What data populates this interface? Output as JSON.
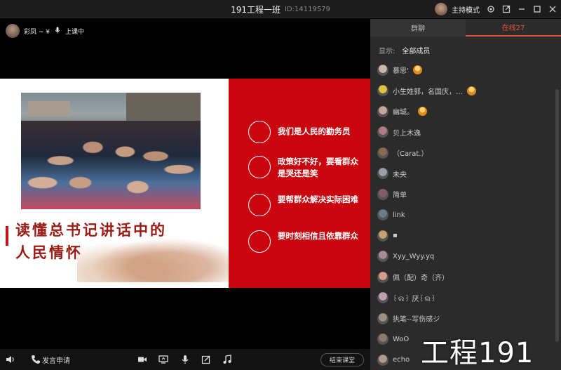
{
  "window": {
    "title": "191工程一班",
    "room_id": "ID:14119579",
    "host_mode": "主持模式"
  },
  "teacher": {
    "name": "彩凤 ~ ¥",
    "status": "上课中"
  },
  "slide": {
    "headline_line1": "读懂总书记讲话中的",
    "headline_line2": "人民情怀",
    "points": [
      "我们是人民的勤务员",
      "政策好不好，要看群众是哭还是笑",
      "要帮群众解决实际困难",
      "要时刻相信且依靠群众"
    ]
  },
  "toolbar": {
    "speak_request": "发言申请",
    "end_class": "结束课堂"
  },
  "panel": {
    "tab_discussion": "群聊",
    "tab_online": "在线27",
    "show_label": "显示:",
    "show_value": "全部成员",
    "members": [
      {
        "name": "慕思'",
        "badge": true,
        "color": "#c9b8a8"
      },
      {
        "name": "小生姓郭，名国庆，…",
        "badge": true,
        "color": "#e0c23a"
      },
      {
        "name": "幽城。",
        "badge": true,
        "color": "#c7a69a"
      },
      {
        "name": "贝上木逸",
        "badge": false,
        "color": "#b07a86"
      },
      {
        "name": "（Carat.）",
        "badge": false,
        "color": "#8a6a4a"
      },
      {
        "name": "未央",
        "badge": false,
        "color": "#9aa0b0"
      },
      {
        "name": "简单",
        "badge": false,
        "color": "#8a5a6a"
      },
      {
        "name": "link",
        "badge": false,
        "color": "#6a7a8a"
      },
      {
        "name": "▪",
        "badge": false,
        "color": "#c9a070"
      },
      {
        "name": "Xyy_Wyy.yq",
        "badge": false,
        "color": "#aa8a9a"
      },
      {
        "name": "佩（配）奇（齐）",
        "badge": false,
        "color": "#d49a8a"
      },
      {
        "name": "꒰ଲ꒱ 厌꒰ଲ꒱",
        "badge": false,
        "color": "#c0a0b0"
      },
      {
        "name": "执笔--写伤感ジ",
        "badge": false,
        "color": "#a09080"
      },
      {
        "name": "WoO",
        "badge": false,
        "color": "#8a7a6a"
      },
      {
        "name": "echo",
        "badge": false,
        "color": "#b09a8a"
      }
    ]
  },
  "watermark": "工程191"
}
